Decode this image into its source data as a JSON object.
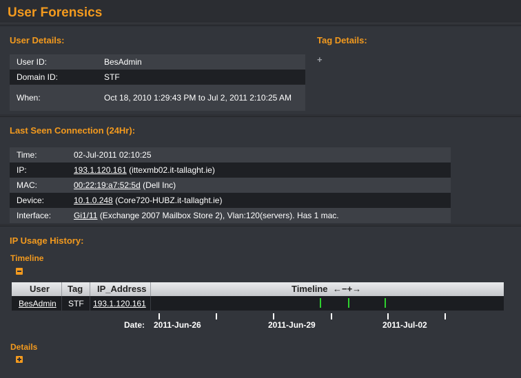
{
  "page": {
    "title": "User Forensics"
  },
  "user_details": {
    "heading": "User Details:",
    "rows": [
      {
        "label": "User ID:",
        "value": "BesAdmin"
      },
      {
        "label": "Domain ID:",
        "value": "STF"
      },
      {
        "label": "When:",
        "value": "Oct 18, 2010 1:29:43 PM to Jul 2, 2011 2:10:25 AM"
      }
    ]
  },
  "tag_details": {
    "heading": "Tag Details:",
    "add_symbol": "+"
  },
  "last_seen": {
    "heading": "Last Seen Connection (24Hr):",
    "time": {
      "label": "Time:",
      "value": "02-Jul-2011 02:10:25"
    },
    "ip": {
      "label": "IP:",
      "link": "193.1.120.161",
      "extra": "(ittexmb02.it-tallaght.ie)"
    },
    "mac": {
      "label": "MAC:",
      "link": "00:22:19:a7:52:5d",
      "extra": "(Dell Inc)"
    },
    "device": {
      "label": "Device:",
      "link": "10.1.0.248",
      "extra": "(Core720-HUBZ.it-tallaght.ie)"
    },
    "interface": {
      "label": "Interface:",
      "link": "Gi1/11",
      "extra": "(Exchange 2007 Mailbox Store 2), Vlan:120(servers). Has 1 mac."
    }
  },
  "ip_usage": {
    "heading": "IP Usage History:",
    "timeline_heading": "Timeline",
    "details_heading": "Details",
    "columns": {
      "user": "User",
      "tag": "Tag",
      "ip": "IP_Address",
      "timeline": "Timeline",
      "nav": "←−+→"
    },
    "row": {
      "user": "BesAdmin",
      "tag": "STF",
      "ip": "193.1.120.161"
    },
    "axis": {
      "label": "Date:",
      "dates": [
        "2011-Jun-26",
        "2011-Jun-29",
        "2011-Jul-02"
      ]
    }
  },
  "colors": {
    "accent": "#f39a1e",
    "marker": "#2fd12f"
  }
}
